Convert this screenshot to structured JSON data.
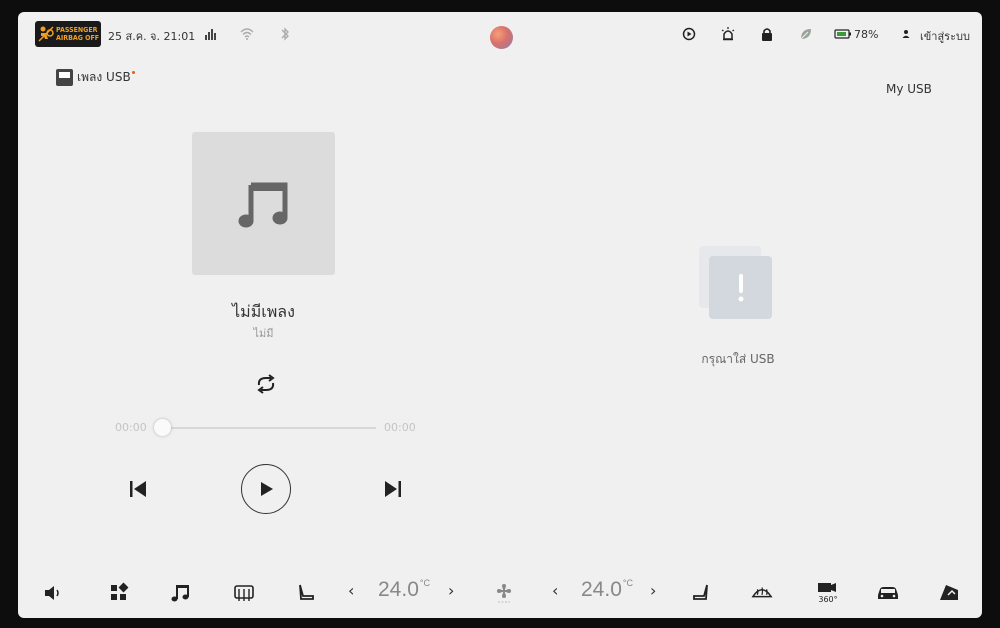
{
  "status": {
    "airbag_line1": "PASSENGER",
    "airbag_line2": "AIRBAG OFF",
    "datetime": "25 ส.ค. จ. 21:01",
    "battery_percent": "78%",
    "login_label": "เข้าสู่ระบบ",
    "icons": [
      "signal-icon",
      "wifi-icon",
      "bluetooth-icon",
      "siri-orb",
      "play-circle-icon",
      "alarm-icon",
      "lock-icon",
      "leaf-icon",
      "battery-icon",
      "user-icon"
    ]
  },
  "source": {
    "label": "เพลง USB",
    "right_label": "My  USB"
  },
  "player": {
    "title": "ไม่มีเพลง",
    "artist": "ไม่มี",
    "time_elapsed": "00:00",
    "time_total": "00:00",
    "progress": 0
  },
  "usb_empty": {
    "message": "กรุณาใส่ USB"
  },
  "climate": {
    "left_temp": "24.0",
    "right_temp": "24.0",
    "unit": "°C"
  },
  "bottom_icons": [
    "volume-icon",
    "apps-icon",
    "music-icon",
    "rear-defrost-icon",
    "seat-left-icon",
    "fan-icon",
    "seat-right-icon",
    "front-defrost-icon",
    "camera-360-icon",
    "car-icon",
    "settings-icon"
  ],
  "colors": {
    "screen_bg": "#f0f0f0",
    "airbag_warning": "#f0a020",
    "text_dark": "#333333",
    "text_light": "#999999"
  }
}
